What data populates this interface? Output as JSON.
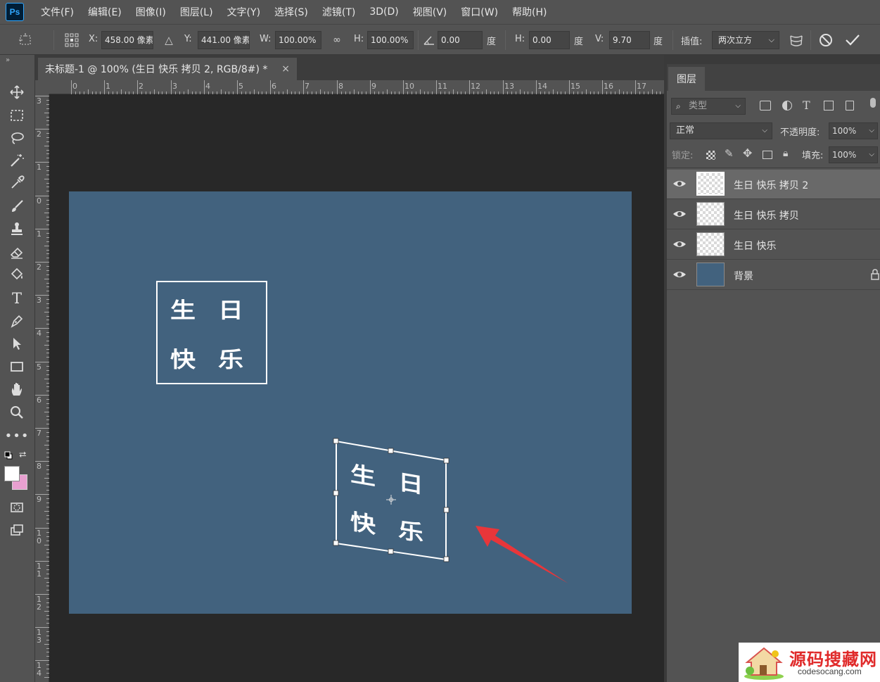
{
  "app": {
    "logo_text": "Ps"
  },
  "menu": [
    "文件(F)",
    "编辑(E)",
    "图像(I)",
    "图层(L)",
    "文字(Y)",
    "选择(S)",
    "滤镜(T)",
    "3D(D)",
    "视图(V)",
    "窗口(W)",
    "帮助(H)"
  ],
  "options": {
    "x_label": "X:",
    "x_value": "458.00 像素",
    "y_label": "Y:",
    "y_value": "441.00 像素",
    "w_label": "W:",
    "w_value": "100.00%",
    "h_label": "H:",
    "h_value": "100.00%",
    "angle_value": "0.00",
    "angle_unit": "度",
    "skew_h_label": "H:",
    "skew_h_value": "0.00",
    "skew_h_unit": "度",
    "skew_v_label": "V:",
    "skew_v_value": "9.70",
    "skew_v_unit": "度",
    "interp_label": "插值:",
    "interp_value": "两次立方"
  },
  "document": {
    "tab_title": "未标题-1 @ 100% (生日 快乐 拷贝 2, RGB/8#) *",
    "close": "×",
    "canvas_color": "#42627e",
    "seal_chars": [
      "生",
      "日",
      "快",
      "乐"
    ]
  },
  "rulers": {
    "h_labels": [
      "0",
      "1",
      "2",
      "3",
      "4",
      "5",
      "6",
      "7",
      "8",
      "9",
      "10",
      "11",
      "12",
      "13",
      "14",
      "15",
      "16",
      "17"
    ],
    "v_labels": [
      "3",
      "2",
      "1",
      "0",
      "1",
      "2",
      "3",
      "4",
      "5",
      "6",
      "7",
      "8",
      "9",
      "10",
      "11",
      "12",
      "13",
      "14"
    ]
  },
  "layers_panel": {
    "tab_label": "图层",
    "filter_placeholder": "类型",
    "blend_mode": "正常",
    "opacity_label": "不透明度:",
    "opacity_value": "100%",
    "lock_label": "锁定:",
    "fill_label": "填充:",
    "fill_value": "100%",
    "layers": [
      {
        "name": "生日 快乐 拷贝 2",
        "selected": true,
        "type": "transparent"
      },
      {
        "name": "生日 快乐 拷贝",
        "selected": false,
        "type": "transparent"
      },
      {
        "name": "生日 快乐",
        "selected": false,
        "type": "transparent"
      },
      {
        "name": "背景",
        "selected": false,
        "type": "background",
        "color": "#42627e"
      }
    ]
  },
  "watermark": {
    "title": "源码搜藏网",
    "url": "codesocang.com"
  }
}
